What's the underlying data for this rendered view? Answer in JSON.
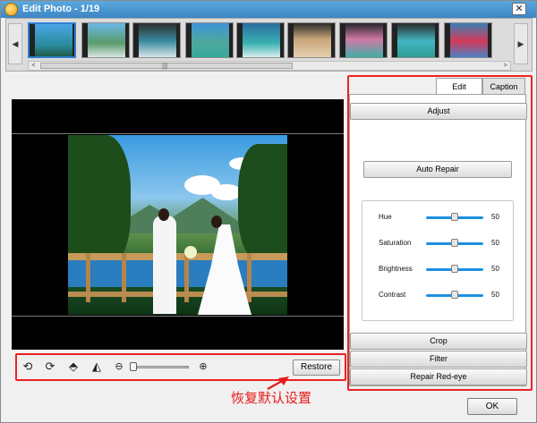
{
  "window": {
    "title": "Edit Photo - 1/19",
    "close_glyph": "✕",
    "accent_color": "#3c86c6"
  },
  "filmstrip": {
    "left_arrow": "◀",
    "right_arrow": "▶",
    "thumbnails": [
      {
        "selected": true
      },
      {
        "selected": false
      },
      {
        "selected": false
      },
      {
        "selected": false
      },
      {
        "selected": false
      },
      {
        "selected": false
      },
      {
        "selected": false
      },
      {
        "selected": false
      },
      {
        "selected": false
      }
    ],
    "scroll_left": "<",
    "scroll_right": ">",
    "scroll_grip": "|||"
  },
  "toolbar": {
    "icons": [
      "rotate-left-icon",
      "rotate-right-icon",
      "flip-vertical-icon",
      "flip-horizontal-icon",
      "zoom-out-icon",
      "zoom-in-icon"
    ],
    "zoom_level": 0,
    "restore_label": "Restore"
  },
  "panel": {
    "tabs": [
      {
        "label": "Edit",
        "active": true
      },
      {
        "label": "Caption",
        "active": false
      }
    ],
    "adjust_label": "Adjust",
    "auto_repair_label": "Auto Repair",
    "sliders": [
      {
        "label": "Hue",
        "value": "50"
      },
      {
        "label": "Saturation",
        "value": "50"
      },
      {
        "label": "Brightness",
        "value": "50"
      },
      {
        "label": "Contrast",
        "value": "50"
      }
    ],
    "crop_label": "Crop",
    "filter_label": "Filter",
    "red_eye_label": "Repair Red-eye"
  },
  "ok_label": "OK",
  "annotation": {
    "text": "恢复默认设置",
    "color": "#e81818"
  }
}
